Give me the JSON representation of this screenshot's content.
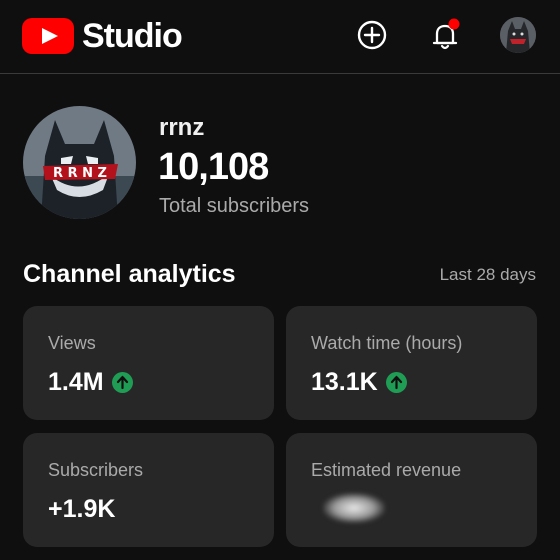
{
  "header": {
    "app_name": "Studio",
    "icons": [
      "youtube-logo-icon",
      "create-icon",
      "notification-bell-icon",
      "account-avatar"
    ],
    "accent_color": "#ff0000",
    "notification_dot_color": "#ff0000"
  },
  "channel": {
    "name": "rrnz",
    "subscriber_count": "10,108",
    "subscriber_label": "Total subscribers"
  },
  "analytics": {
    "title": "Channel analytics",
    "period": "Last 28 days",
    "cards": [
      {
        "label": "Views",
        "value": "1.4M",
        "trend": "up"
      },
      {
        "label": "Watch time (hours)",
        "value": "13.1K",
        "trend": "up"
      },
      {
        "label": "Subscribers",
        "value": "+1.9K"
      },
      {
        "label": "Estimated revenue",
        "value": ""
      }
    ],
    "trend_up_color": "#1f9d55"
  }
}
